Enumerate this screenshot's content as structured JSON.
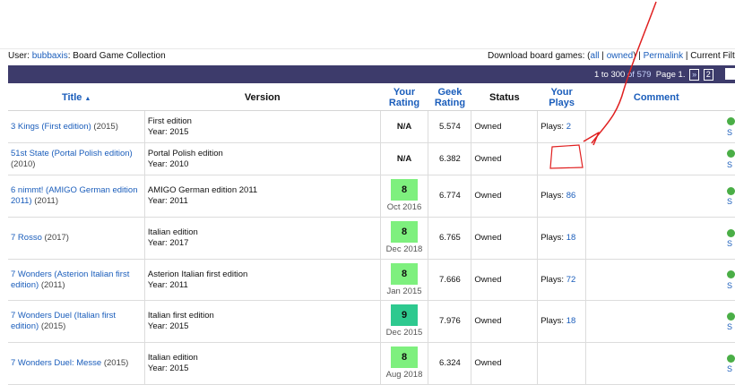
{
  "header": {
    "user_label": "User:",
    "username": "bubbaxis",
    "collection_title": ": Board Game Collection",
    "download_label": "Download board games: (",
    "download_all": "all",
    "download_sep": " | ",
    "download_owned": "owned",
    "download_close": ") |",
    "permalink": "Permalink",
    "current_filters": "| Current Filte"
  },
  "pager": {
    "range": "1 to 300",
    "of_label": "of",
    "total": "579",
    "page_label": "Page 1.",
    "next": "»",
    "page2": "2"
  },
  "columns": {
    "title": "Title",
    "version": "Version",
    "your_rating": "Your Rating",
    "geek_rating": "Geek Rating",
    "status": "Status",
    "your_plays": "Your Plays",
    "comment": "Comment"
  },
  "rows": [
    {
      "title": "3 Kings (First edition)",
      "year": "(2015)",
      "edition": "First edition",
      "edition_year": "Year: 2015",
      "rating": "N/A",
      "rating_date": "",
      "rating_color": "",
      "geek": "5.574",
      "status": "Owned",
      "plays_label": "Plays:",
      "plays": "2"
    },
    {
      "title": "51st State (Portal Polish edition)",
      "year": "(2010)",
      "edition": "Portal Polish edition",
      "edition_year": "Year: 2010",
      "rating": "N/A",
      "rating_date": "",
      "rating_color": "",
      "geek": "6.382",
      "status": "Owned",
      "plays_label": "",
      "plays": ""
    },
    {
      "title": "6 nimmt! (AMIGO German edition 2011)",
      "year": "(2011)",
      "edition": "AMIGO German edition 2011",
      "edition_year": "Year: 2011",
      "rating": "8",
      "rating_date": "Oct 2016",
      "rating_color": "#7ef07e",
      "geek": "6.774",
      "status": "Owned",
      "plays_label": "Plays:",
      "plays": "86"
    },
    {
      "title": "7 Rosso",
      "year": "(2017)",
      "edition": "Italian edition",
      "edition_year": "Year: 2017",
      "rating": "8",
      "rating_date": "Dec 2018",
      "rating_color": "#7ef07e",
      "geek": "6.765",
      "status": "Owned",
      "plays_label": "Plays:",
      "plays": "18"
    },
    {
      "title": "7 Wonders (Asterion Italian first edition)",
      "year": "(2011)",
      "edition": "Asterion Italian first edition",
      "edition_year": "Year: 2011",
      "rating": "8",
      "rating_date": "Jan 2015",
      "rating_color": "#7ef07e",
      "geek": "7.666",
      "status": "Owned",
      "plays_label": "Plays:",
      "plays": "72"
    },
    {
      "title": "7 Wonders Duel (Italian first edition)",
      "year": "(2015)",
      "edition": "Italian first edition",
      "edition_year": "Year: 2015",
      "rating": "9",
      "rating_date": "Dec 2015",
      "rating_color": "#2ec98f",
      "geek": "7.976",
      "status": "Owned",
      "plays_label": "Plays:",
      "plays": "18"
    },
    {
      "title": "7 Wonders Duel: Messe",
      "year": "(2015)",
      "edition": "Italian edition",
      "edition_year": "Year: 2015",
      "rating": "8",
      "rating_date": "Aug 2018",
      "rating_color": "#7ef07e",
      "geek": "6.324",
      "status": "Owned",
      "plays_label": "",
      "plays": ""
    }
  ],
  "edge_letter": "S",
  "colors": {
    "link": "#1a5dbb",
    "pager_bg": "#3d3b6b",
    "rating_8": "#7ef07e",
    "rating_9": "#2ec98f",
    "annotation": "#e02020"
  }
}
